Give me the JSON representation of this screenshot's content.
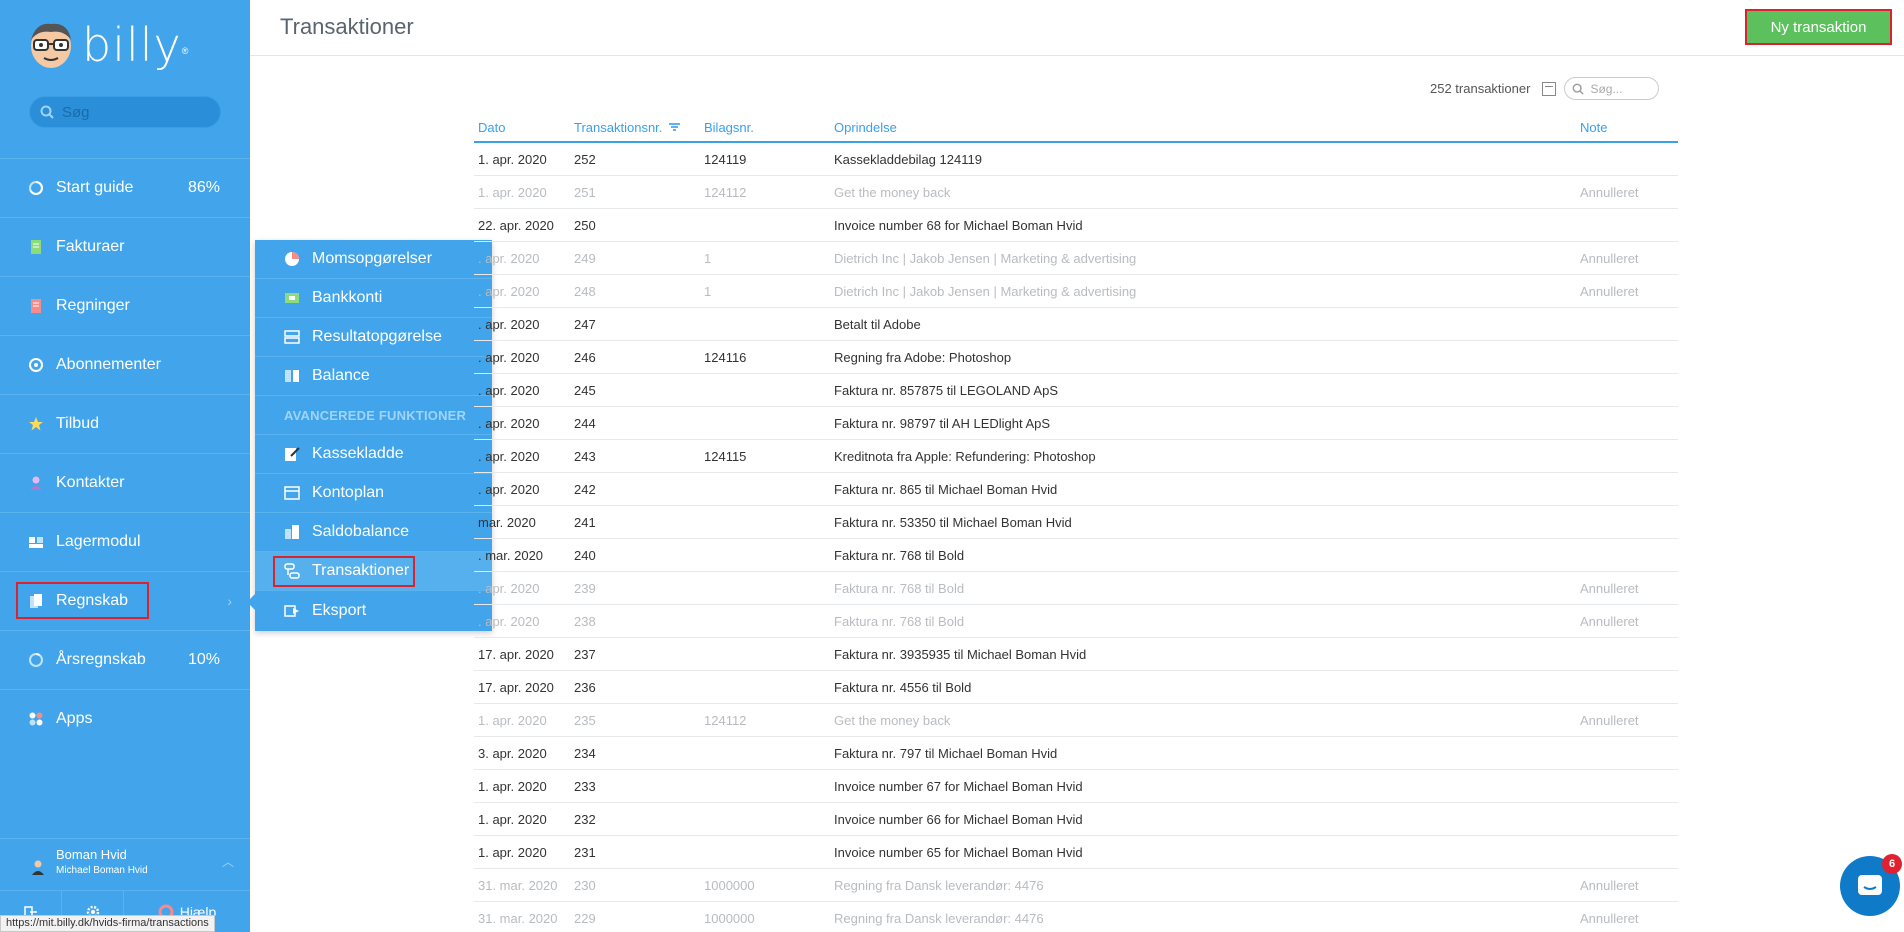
{
  "app": {
    "logo": "billy",
    "logo_mark": "®"
  },
  "sidebar": {
    "search_placeholder": "Søg",
    "items": [
      {
        "label": "Start guide",
        "icon": "progress-circle-icon",
        "value": "86%"
      },
      {
        "label": "Fakturaer",
        "icon": "invoice-icon"
      },
      {
        "label": "Regninger",
        "icon": "bill-icon"
      },
      {
        "label": "Abonnementer",
        "icon": "subscription-icon"
      },
      {
        "label": "Tilbud",
        "icon": "star-badge-icon"
      },
      {
        "label": "Kontakter",
        "icon": "contact-icon"
      },
      {
        "label": "Lagermodul",
        "icon": "inventory-icon"
      },
      {
        "label": "Regnskab",
        "icon": "accounting-icon"
      },
      {
        "label": "Årsregnskab",
        "icon": "progress-circle-icon",
        "value": "10%"
      },
      {
        "label": "Apps",
        "icon": "apps-icon"
      }
    ],
    "user": {
      "name": "Boman Hvid",
      "company": "Michael Boman Hvid"
    },
    "help_label": "Hjælp"
  },
  "dropdown": {
    "items": [
      {
        "label": "Momsopgørelser",
        "icon": "pie-chart-icon"
      },
      {
        "label": "Bankkonti",
        "icon": "bank-icon"
      },
      {
        "label": "Resultatopgørelse",
        "icon": "report-icon"
      },
      {
        "label": "Balance",
        "icon": "balance-icon"
      }
    ],
    "section_label": "AVANCEREDE FUNKTIONER",
    "advanced": [
      {
        "label": "Kassekladde",
        "icon": "edit-icon"
      },
      {
        "label": "Kontoplan",
        "icon": "ledger-icon"
      },
      {
        "label": "Saldobalance",
        "icon": "trial-balance-icon"
      },
      {
        "label": "Transaktioner",
        "icon": "transactions-icon"
      },
      {
        "label": "Eksport",
        "icon": "export-icon"
      }
    ]
  },
  "header": {
    "title": "Transaktioner",
    "new_button": "Ny transaktion"
  },
  "toolbar": {
    "count": "252 transaktioner",
    "search_placeholder": "Søg..."
  },
  "table": {
    "columns": [
      "Dato",
      "Transaktionsnr.",
      "Bilagsnr.",
      "Oprindelse",
      "Note"
    ],
    "rows": [
      {
        "date": "1. apr. 2020",
        "num": "252",
        "bilag": "124119",
        "origin": "Kassekladdebilag 124119",
        "note": "",
        "cancelled": false
      },
      {
        "date": "1. apr. 2020",
        "num": "251",
        "bilag": "124112",
        "origin": "Get the money back",
        "note": "Annulleret",
        "cancelled": true
      },
      {
        "date": "22. apr. 2020",
        "num": "250",
        "bilag": "",
        "origin": "Invoice number 68 for Michael Boman Hvid",
        "note": "",
        "cancelled": false
      },
      {
        "date": ". apr. 2020",
        "num": "249",
        "bilag": "1",
        "origin": "Dietrich Inc | Jakob Jensen | Marketing & advertising",
        "note": "Annulleret",
        "cancelled": true
      },
      {
        "date": ". apr. 2020",
        "num": "248",
        "bilag": "1",
        "origin": "Dietrich Inc | Jakob Jensen | Marketing & advertising",
        "note": "Annulleret",
        "cancelled": true
      },
      {
        "date": ". apr. 2020",
        "num": "247",
        "bilag": "",
        "origin": "Betalt til Adobe",
        "note": "",
        "cancelled": false
      },
      {
        "date": ". apr. 2020",
        "num": "246",
        "bilag": "124116",
        "origin": "Regning fra Adobe: Photoshop",
        "note": "",
        "cancelled": false
      },
      {
        "date": ". apr. 2020",
        "num": "245",
        "bilag": "",
        "origin": "Faktura nr. 857875 til LEGOLAND ApS",
        "note": "",
        "cancelled": false
      },
      {
        "date": ". apr. 2020",
        "num": "244",
        "bilag": "",
        "origin": "Faktura nr. 98797 til AH LEDlight ApS",
        "note": "",
        "cancelled": false
      },
      {
        "date": ". apr. 2020",
        "num": "243",
        "bilag": "124115",
        "origin": "Kreditnota fra Apple: Refundering: Photoshop",
        "note": "",
        "cancelled": false
      },
      {
        "date": ". apr. 2020",
        "num": "242",
        "bilag": "",
        "origin": "Faktura nr. 865 til Michael Boman Hvid",
        "note": "",
        "cancelled": false
      },
      {
        "date": "mar. 2020",
        "num": "241",
        "bilag": "",
        "origin": "Faktura nr. 53350 til Michael Boman Hvid",
        "note": "",
        "cancelled": false
      },
      {
        "date": ". mar. 2020",
        "num": "240",
        "bilag": "",
        "origin": "Faktura nr. 768 til Bold",
        "note": "",
        "cancelled": false
      },
      {
        "date": ". apr. 2020",
        "num": "239",
        "bilag": "",
        "origin": "Faktura nr. 768 til Bold",
        "note": "Annulleret",
        "cancelled": true
      },
      {
        "date": ". apr. 2020",
        "num": "238",
        "bilag": "",
        "origin": "Faktura nr. 768 til Bold",
        "note": "Annulleret",
        "cancelled": true
      },
      {
        "date": "17. apr. 2020",
        "num": "237",
        "bilag": "",
        "origin": "Faktura nr. 3935935 til Michael Boman Hvid",
        "note": "",
        "cancelled": false
      },
      {
        "date": "17. apr. 2020",
        "num": "236",
        "bilag": "",
        "origin": "Faktura nr. 4556 til Bold",
        "note": "",
        "cancelled": false
      },
      {
        "date": "1. apr. 2020",
        "num": "235",
        "bilag": "124112",
        "origin": "Get the money back",
        "note": "Annulleret",
        "cancelled": true
      },
      {
        "date": "3. apr. 2020",
        "num": "234",
        "bilag": "",
        "origin": "Faktura nr. 797 til Michael Boman Hvid",
        "note": "",
        "cancelled": false
      },
      {
        "date": "1. apr. 2020",
        "num": "233",
        "bilag": "",
        "origin": "Invoice number 67 for Michael Boman Hvid",
        "note": "",
        "cancelled": false
      },
      {
        "date": "1. apr. 2020",
        "num": "232",
        "bilag": "",
        "origin": "Invoice number 66 for Michael Boman Hvid",
        "note": "",
        "cancelled": false
      },
      {
        "date": "1. apr. 2020",
        "num": "231",
        "bilag": "",
        "origin": "Invoice number 65 for Michael Boman Hvid",
        "note": "",
        "cancelled": false
      },
      {
        "date": "31. mar. 2020",
        "num": "230",
        "bilag": "1000000",
        "origin": "Regning fra Dansk leverandør: 4476",
        "note": "Annulleret",
        "cancelled": true
      },
      {
        "date": "31. mar. 2020",
        "num": "229",
        "bilag": "1000000",
        "origin": "Regning fra Dansk leverandør: 4476",
        "note": "Annulleret",
        "cancelled": true
      }
    ]
  },
  "statusbar": {
    "url": "https://mit.billy.dk/hvids-firma/transactions"
  },
  "chat": {
    "badge": "6"
  },
  "colors": {
    "sidebar": "#42a5ec",
    "accent": "#3aa0ea",
    "button": "#5cc15c",
    "highlight": "#d9232f"
  }
}
